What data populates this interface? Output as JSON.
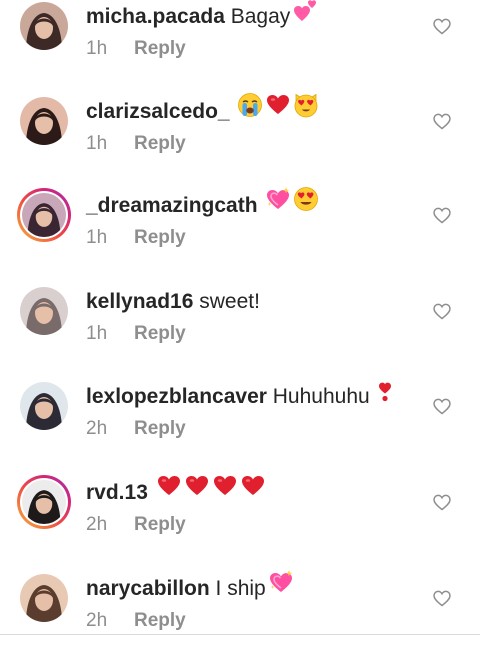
{
  "comments": [
    {
      "username": "micha.pacada",
      "text": "Bagay",
      "emojis": [
        "two-hearts"
      ],
      "time": "1h",
      "reply": "Reply",
      "has_story": false,
      "avatar_colors": [
        "#c9a89a",
        "#3d2a26"
      ]
    },
    {
      "username": "clarizsalcedo_",
      "text": "",
      "emojis": [
        "crying-face",
        "red-heart",
        "heart-eyes-cat"
      ],
      "time": "1h",
      "reply": "Reply",
      "has_story": false,
      "avatar_colors": [
        "#e3b9a8",
        "#2b1a17"
      ]
    },
    {
      "username": "_dreamazingcath",
      "text": "",
      "emojis": [
        "sparkling-heart",
        "heart-eyes"
      ],
      "time": "1h",
      "reply": "Reply",
      "has_story": true,
      "avatar_colors": [
        "#c7a7b8",
        "#3a2633"
      ]
    },
    {
      "username": "kellynad16",
      "text": "sweet!",
      "emojis": [],
      "time": "1h",
      "reply": "Reply",
      "has_story": false,
      "avatar_colors": [
        "#d9cfcf",
        "#7a6b6b"
      ]
    },
    {
      "username": "lexlopezblancaver",
      "text": "Huhuhuhu",
      "emojis": [
        "exclamation"
      ],
      "time": "2h",
      "reply": "Reply",
      "has_story": false,
      "avatar_colors": [
        "#dfe6ec",
        "#2c2a35"
      ]
    },
    {
      "username": "rvd.13",
      "text": "",
      "emojis": [
        "red-heart",
        "red-heart",
        "red-heart",
        "red-heart"
      ],
      "time": "2h",
      "reply": "Reply",
      "has_story": true,
      "avatar_colors": [
        "#ececec",
        "#1f1a1a"
      ]
    },
    {
      "username": "narycabillon",
      "text": "I ship",
      "emojis": [
        "sparkling-heart"
      ],
      "time": "2h",
      "reply": "Reply",
      "has_story": false,
      "avatar_colors": [
        "#e8c9b4",
        "#5a3d2e"
      ]
    }
  ],
  "colors": {
    "text": "#262626",
    "meta": "#8e8e8e",
    "heart_outline": "#8e8e8e",
    "red_heart": "#e0202f",
    "pink_heart": "#ff5aa5"
  }
}
